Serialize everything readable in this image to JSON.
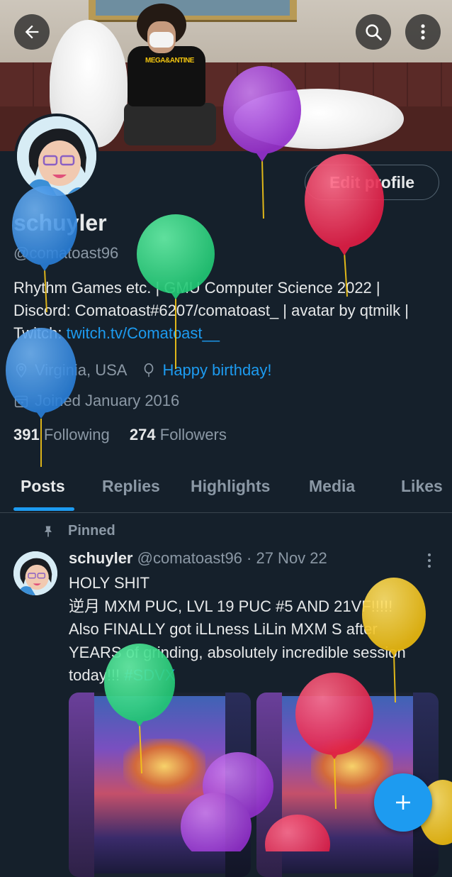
{
  "header": {
    "back_icon": "arrow-left-icon",
    "search_icon": "search-icon",
    "more_icon": "more-vertical-icon",
    "banner_shirt_text": "MEGA&ANTINE"
  },
  "profile": {
    "edit_label": "Edit profile",
    "name": "schuyler",
    "handle": "@comatoast96",
    "bio_text": "Rhythm Games etc. | GMU Computer Science 2022 | Discord: Comatoast#6207/comatoast_ | avatar by qtmilk | Twitch: ",
    "bio_link": "twitch.tv/Comatoast__",
    "location": "Virginia, USA",
    "birthday": "Happy birthday!",
    "joined": "Joined January 2016",
    "following_count": "391",
    "following_label": "Following",
    "followers_count": "274",
    "followers_label": "Followers"
  },
  "tabs": [
    "Posts",
    "Replies",
    "Highlights",
    "Media",
    "Likes"
  ],
  "tweet": {
    "pinned_label": "Pinned",
    "author": "schuyler",
    "meta": "@comatoast96 · 27 Nov 22",
    "text": "HOLY SHIT\n逆月 MXM PUC, LVL 19 PUC #5 AND 21VF!!!!!\nAlso FINALLY got iLLness LiLin MXM S after YEARS of grinding, absolutely incredible session today!!! ",
    "hashtag": "#SDVX"
  },
  "fab_icon": "plus-icon",
  "colors": {
    "background": "#15202b",
    "accent": "#1d9bf0",
    "secondary_text": "#8b98a5",
    "balloon_purple": "#a23fd9",
    "balloon_red": "#e8264e",
    "balloon_blue": "#2f86e0",
    "balloon_green": "#2ed47f",
    "balloon_yellow": "#f2c418"
  }
}
